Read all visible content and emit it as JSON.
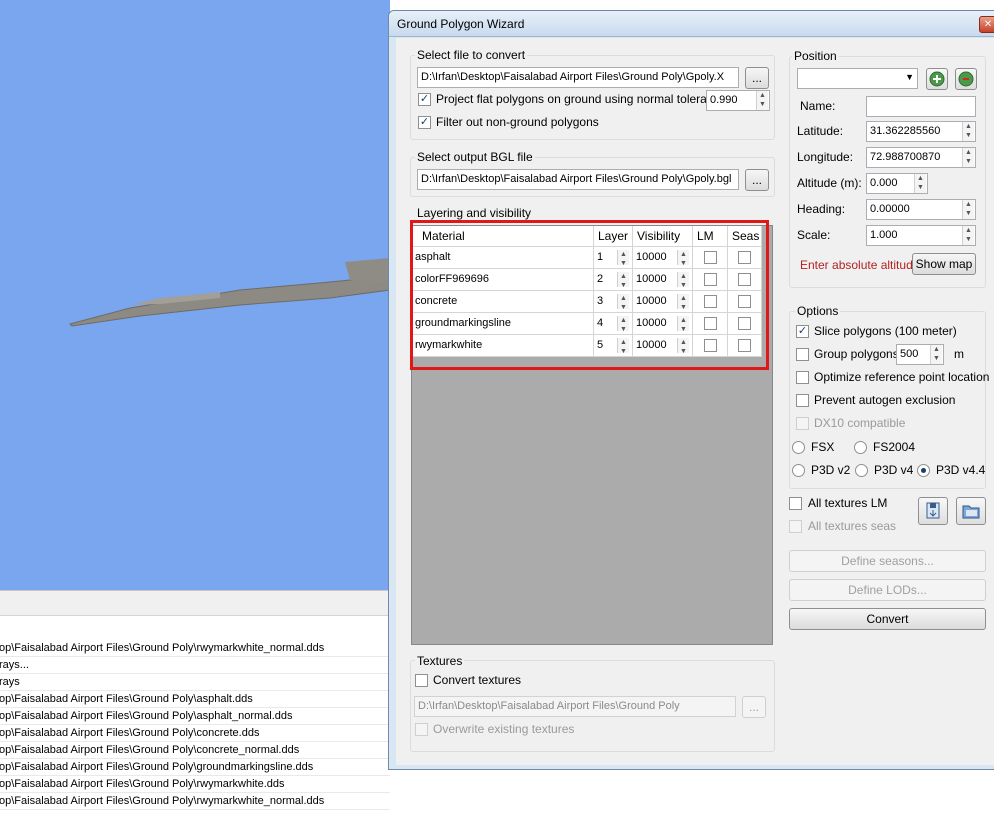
{
  "window": {
    "title": "Ground Polygon Wizard",
    "close_glyph": "✕"
  },
  "file_section": {
    "title": "Select file to convert",
    "path": "D:\\Irfan\\Desktop\\Faisalabad Airport Files\\Ground Poly\\Gpoly.X",
    "browse": "...",
    "project_label": "Project flat polygons on ground using normal tolerance:",
    "project_checked": true,
    "tolerance": "0.990",
    "filter_label": "Filter out non-ground polygons",
    "filter_checked": true
  },
  "output_section": {
    "title": "Select output BGL file",
    "path": "D:\\Irfan\\Desktop\\Faisalabad Airport Files\\Ground Poly\\Gpoly.bgl",
    "browse": "..."
  },
  "layering": {
    "title": "Layering and visibility",
    "headers": [
      "Material",
      "Layer",
      "Visibility",
      "LM",
      "Seas"
    ],
    "rows": [
      {
        "material": "asphalt",
        "layer": "1",
        "visibility": "10000",
        "lm": false,
        "seas": false
      },
      {
        "material": "colorFF969696",
        "layer": "2",
        "visibility": "10000",
        "lm": false,
        "seas": false
      },
      {
        "material": "concrete",
        "layer": "3",
        "visibility": "10000",
        "lm": false,
        "seas": false
      },
      {
        "material": "groundmarkingsline",
        "layer": "4",
        "visibility": "10000",
        "lm": false,
        "seas": false
      },
      {
        "material": "rwymarkwhite",
        "layer": "5",
        "visibility": "10000",
        "lm": false,
        "seas": false
      }
    ],
    "highlight_color": "#e01818"
  },
  "textures": {
    "title": "Textures",
    "convert_label": "Convert textures",
    "convert_checked": false,
    "path": "D:\\Irfan\\Desktop\\Faisalabad Airport Files\\Ground Poly",
    "browse": "...",
    "overwrite_label": "Overwrite existing textures"
  },
  "position": {
    "title": "Position",
    "preset": "",
    "name_label": "Name:",
    "name_value": "",
    "latitude_label": "Latitude:",
    "latitude": "31.362285560",
    "longitude_label": "Longitude:",
    "longitude": "72.988700870",
    "altitude_label": "Altitude (m):",
    "altitude": "0.000",
    "heading_label": "Heading:",
    "heading": "0.00000",
    "scale_label": "Scale:",
    "scale": "1.000",
    "warning": "Enter absolute altitude!",
    "show_map": "Show map",
    "add_icon": "globe-add-icon",
    "remove_icon": "globe-remove-icon"
  },
  "options": {
    "title": "Options",
    "slice_label": "Slice polygons (100 meter)",
    "slice_checked": true,
    "group_label": "Group polygons",
    "group_value": "500",
    "group_unit": "m",
    "optimize_label": "Optimize reference point location",
    "prevent_label": "Prevent autogen exclusion",
    "dx10_label": "DX10 compatible",
    "radios": [
      "FSX",
      "FS2004",
      "P3D v2",
      "P3D v4",
      "P3D v4.4"
    ],
    "selected_radio": "P3D v4.4"
  },
  "textures_flags": {
    "all_lm_label": "All textures LM",
    "all_seas_label": "All textures seas",
    "save_icon": "save-icon",
    "open_icon": "open-folder-icon"
  },
  "buttons": {
    "define_seasons": "Define seasons...",
    "define_lods": "Define LODs...",
    "convert": "Convert"
  },
  "log": [
    "op\\Faisalabad Airport Files\\Ground Poly\\rwymarkwhite_normal.dds",
    "rays...",
    "rays",
    "op\\Faisalabad Airport Files\\Ground Poly\\asphalt.dds",
    "op\\Faisalabad Airport Files\\Ground Poly\\asphalt_normal.dds",
    "op\\Faisalabad Airport Files\\Ground Poly\\concrete.dds",
    "op\\Faisalabad Airport Files\\Ground Poly\\concrete_normal.dds",
    "op\\Faisalabad Airport Files\\Ground Poly\\groundmarkingsline.dds",
    "op\\Faisalabad Airport Files\\Ground Poly\\rwymarkwhite.dds",
    "op\\Faisalabad Airport Files\\Ground Poly\\rwymarkwhite_normal.dds"
  ]
}
